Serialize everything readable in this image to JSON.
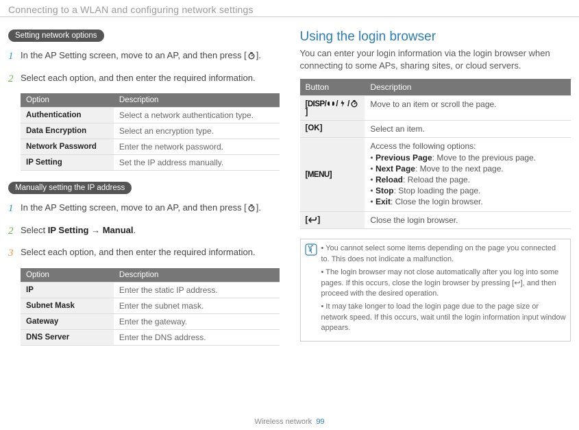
{
  "header": "Connecting to a WLAN and configuring network settings",
  "left": {
    "pill1": "Setting network options",
    "step1": {
      "text_a": "In the AP Setting screen, move to an AP, and then press [",
      "text_b": "]."
    },
    "step2": "Select each option, and then enter the required information.",
    "table1": {
      "head_opt": "Option",
      "head_desc": "Description",
      "rows": [
        {
          "l": "Authentication",
          "r": "Select a network authentication type."
        },
        {
          "l": "Data Encryption",
          "r": "Select an encryption type."
        },
        {
          "l": "Network Password",
          "r": "Enter the network password."
        },
        {
          "l": "IP Setting",
          "r": "Set the IP address manually."
        }
      ]
    },
    "pill2": "Manually setting the IP address",
    "step3": {
      "text_a": "In the AP Setting screen, move to an AP, and then press [",
      "text_b": "]."
    },
    "step4": {
      "a": "Select ",
      "b": "IP Setting",
      "c": " → ",
      "d": "Manual",
      "e": "."
    },
    "step5": "Select each option, and then enter the required information.",
    "table2": {
      "head_opt": "Option",
      "head_desc": "Description",
      "rows": [
        {
          "l": "IP",
          "r": "Enter the static IP address."
        },
        {
          "l": "Subnet Mask",
          "r": "Enter the subnet mask."
        },
        {
          "l": "Gateway",
          "r": "Enter the gateway."
        },
        {
          "l": "DNS Server",
          "r": "Enter the DNS address."
        }
      ]
    }
  },
  "right": {
    "title": "Using the login browser",
    "intro": "You can enter your login information via the login browser when connecting to some APs, sharing sites, or cloud servers.",
    "table": {
      "head_btn": "Button",
      "head_desc": "Description",
      "row1": {
        "btn": "[DISP/",
        "btn_end": "]",
        "desc": "Move to an item or scroll the page."
      },
      "row2": {
        "btn": "[OK]",
        "desc": "Select an item."
      },
      "row3": {
        "btn": "[MENU]",
        "intro": "Access the following options:",
        "opts": [
          {
            "b": "Previous Page",
            "t": ": Move to the previous page."
          },
          {
            "b": "Next Page",
            "t": ": Move to the next page."
          },
          {
            "b": "Reload",
            "t": ": Reload the page."
          },
          {
            "b": "Stop",
            "t": ": Stop loading the page."
          },
          {
            "b": "Exit",
            "t": ": Close the login browser."
          }
        ]
      },
      "row4": {
        "desc": "Close the login browser."
      }
    },
    "notes": [
      "You cannot select some items depending on the page you connected to. This does not indicate a malfunction.",
      "The login browser may not close automatically after you log into some pages. If this occurs, close the login browser by pressing [↩], and then proceed with the desired operation.",
      "It may take longer to load the login page due to the page size or network speed. If this occurs, wait until the login information input window appears."
    ]
  },
  "footer": {
    "label": "Wireless network",
    "page": "99"
  }
}
